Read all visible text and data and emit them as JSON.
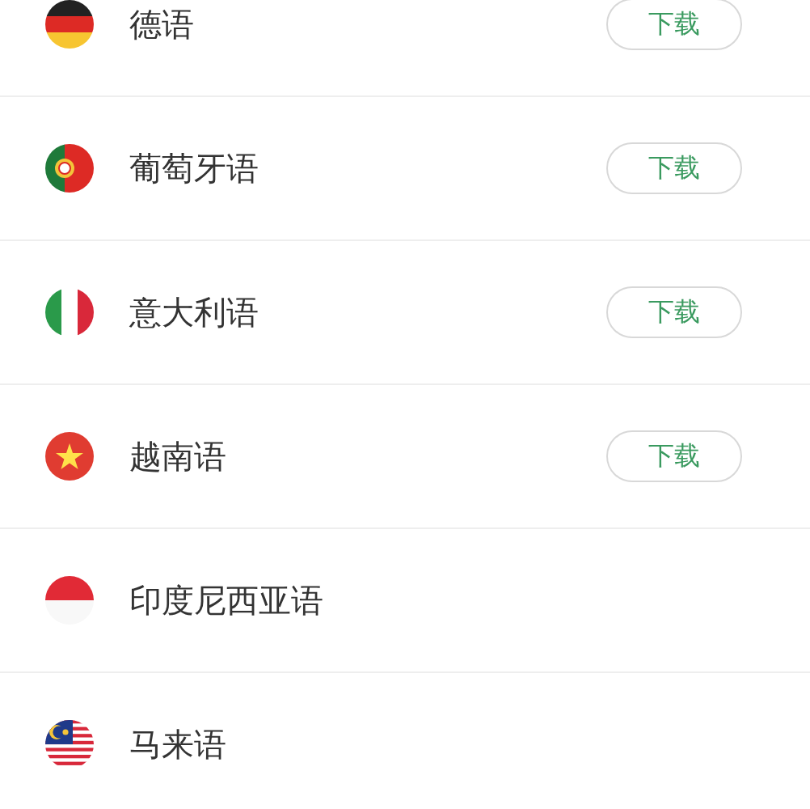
{
  "languages": [
    {
      "kind": "germany",
      "name": "德语",
      "button": "下载"
    },
    {
      "kind": "portugal",
      "name": "葡萄牙语",
      "button": "下载"
    },
    {
      "kind": "italy",
      "name": "意大利语",
      "button": "下载"
    },
    {
      "kind": "vietnam",
      "name": "越南语",
      "button": "下载"
    },
    {
      "kind": "indonesia",
      "name": "印度尼西亚语"
    },
    {
      "kind": "malaysia",
      "name": "马来语"
    }
  ]
}
